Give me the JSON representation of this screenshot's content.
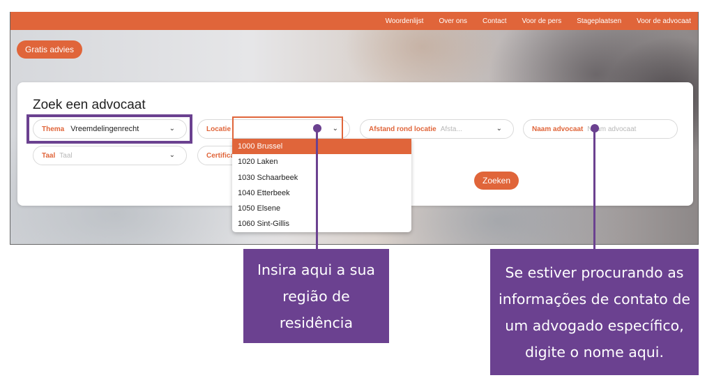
{
  "nav": {
    "links": [
      "Woordenlijst",
      "Over ons",
      "Contact",
      "Voor de pers",
      "Stageplaatsen",
      "Voor de advocaat"
    ]
  },
  "gratis_button": "Gratis advies",
  "search": {
    "title": "Zoek een advocaat",
    "thema": {
      "label": "Thema",
      "value": "Vreemdelingenrecht"
    },
    "locatie": {
      "label": "Locatie",
      "value": ""
    },
    "afstand": {
      "label": "Afstand rond locatie",
      "placeholder": "Afsta..."
    },
    "naam": {
      "label": "Naam advocaat",
      "placeholder": "Naam advocaat"
    },
    "taal": {
      "label": "Taal",
      "placeholder": "Taal"
    },
    "certificaat": {
      "label": "Certifica"
    },
    "submit": "Zoeken"
  },
  "location_options": [
    "1000 Brussel",
    "1020 Laken",
    "1030 Schaarbeek",
    "1040 Etterbeek",
    "1050 Elsene",
    "1060 Sint-Gillis"
  ],
  "annotations": {
    "region_callout": [
      "Insira aqui a sua",
      "região de",
      "residência"
    ],
    "name_callout": [
      "Se estiver procurando as",
      "informações de contato de",
      "um advogado específico,",
      "digite o nome aqui."
    ]
  },
  "colors": {
    "brand_orange": "#e0653a",
    "annotation_purple": "#6b4190"
  }
}
